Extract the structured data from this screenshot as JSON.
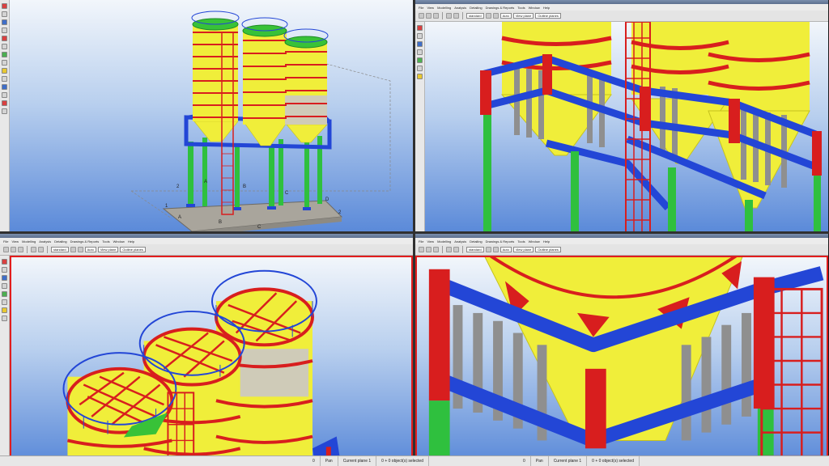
{
  "menu": [
    "File",
    "View",
    "Modelling",
    "Analysis",
    "Detailing",
    "Drawings & Reports",
    "Tools",
    "Window",
    "Help"
  ],
  "toolbar": {
    "view_filter": "standard",
    "snap": "Auto",
    "plane": "View plane",
    "outline": "Outline planes"
  },
  "grid_labels": {
    "letters": [
      "A",
      "B",
      "C",
      "D"
    ],
    "numbers": [
      "1",
      "2"
    ]
  },
  "status": {
    "coord": "0",
    "pan": "Pan",
    "work_plane": "Current plane 1",
    "selection": "0 + 0 object(s) selected"
  },
  "colors": {
    "silo": "#f0ee3a",
    "frame_blue": "#2346d6",
    "column_green": "#2fc03e",
    "bracing_red": "#d81e1e",
    "panel_grey": "#8f8f8f",
    "deck_green": "#38c238"
  }
}
